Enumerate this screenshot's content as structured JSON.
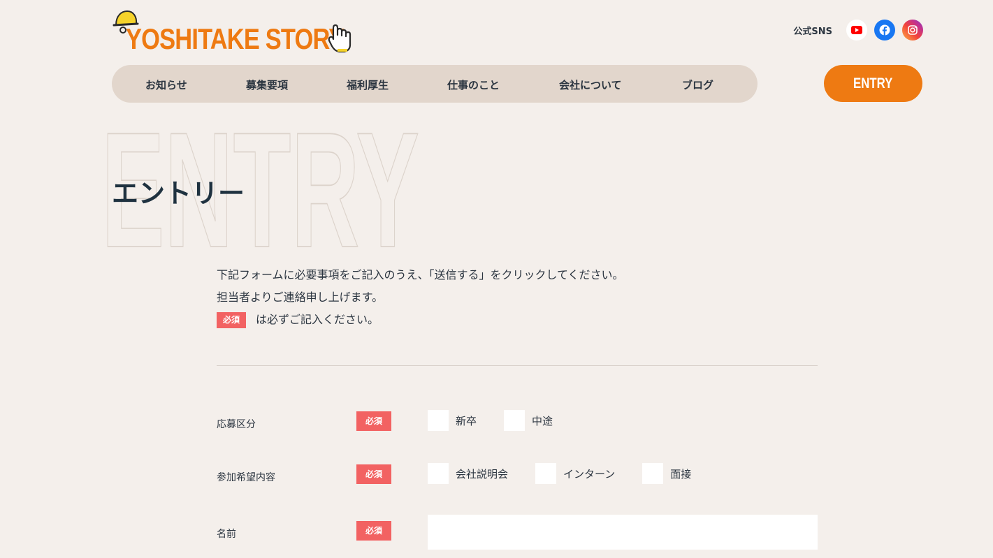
{
  "brand": {
    "logo_text": "YOSHITAKE STORY"
  },
  "sns": {
    "label": "公式SNS",
    "icons": [
      "youtube-icon",
      "facebook-icon",
      "instagram-icon"
    ]
  },
  "nav": [
    "お知らせ",
    "募集要項",
    "福利厚生",
    "仕事のこと",
    "会社について",
    "ブログ"
  ],
  "entry_button": "ENTRY",
  "page": {
    "background_word": "ENTRY",
    "title": "エントリー"
  },
  "intro": {
    "line1": "下記フォームに必要事項をご記入のうえ、「送信する」をクリックしてください。",
    "line2": "担当者よりご連絡申し上げます。",
    "required_badge": "必須",
    "line3": "は必ずご記入ください。"
  },
  "form": {
    "required_label": "必須",
    "fields": [
      {
        "label": "応募区分",
        "type": "checkbox",
        "options": [
          "新卒",
          "中途"
        ]
      },
      {
        "label": "参加希望内容",
        "type": "checkbox",
        "options": [
          "会社説明会",
          "インターン",
          "面接"
        ]
      },
      {
        "label": "名前",
        "type": "text",
        "value": ""
      }
    ]
  },
  "colors": {
    "background": "#f4efeb",
    "accent": "#ee7a12",
    "nav_bg": "#e2d6cc",
    "required": "#f26262",
    "text": "#2b3540"
  }
}
